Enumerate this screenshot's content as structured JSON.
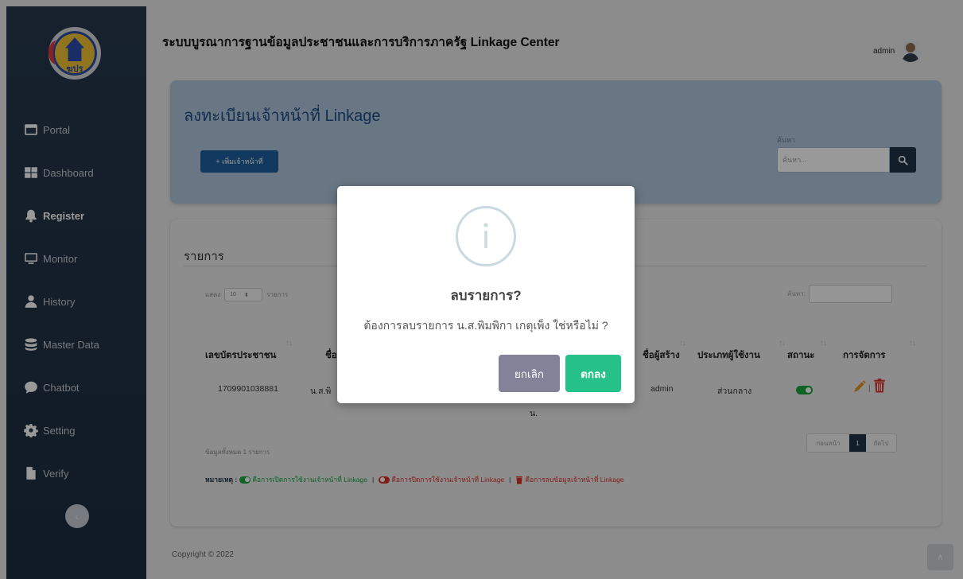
{
  "app": {
    "title": "ระบบบูรณาการฐานข้อมูลประชาชนและการบริการภาครัฐ Linkage Center",
    "user_name": "admin",
    "logo_text": "ฆปร"
  },
  "sidebar": {
    "items": [
      {
        "label": "Portal",
        "icon": "window-icon"
      },
      {
        "label": "Dashboard",
        "icon": "grid-icon"
      },
      {
        "label": "Register",
        "icon": "bell-icon",
        "active": true
      },
      {
        "label": "Monitor",
        "icon": "monitor-icon"
      },
      {
        "label": "History",
        "icon": "user-icon"
      },
      {
        "label": "Master Data",
        "icon": "database-icon"
      },
      {
        "label": "Chatbot",
        "icon": "chat-bubble-icon"
      },
      {
        "label": "Setting",
        "icon": "gear-icon"
      },
      {
        "label": "Verify",
        "icon": "document-icon"
      }
    ],
    "collapse_glyph": "‹"
  },
  "register_card": {
    "title": "ลงทะเบียนเจ้าหน้าที่ Linkage",
    "add_button_label": "+ เพิ่มเจ้าหน้าที่",
    "search_label": "ค้นหา",
    "search_placeholder": "ค้นหา..."
  },
  "list_card": {
    "title": "รายการ",
    "show_prefix": "แสดง",
    "show_value": "10",
    "show_suffix": "รายการ",
    "filter_label": "ค้นหา:",
    "columns": [
      "เลขบัตรประชาชน",
      "ชื่อ",
      "ชื่อผู้สร้าง",
      "ประเภทผู้ใช้งาน",
      "สถานะ",
      "การจัดการ"
    ],
    "rows": [
      {
        "id_number": "1709901038881",
        "name_visible": "น.ส.พิ",
        "name_wrap": "น.",
        "creator": "admin",
        "user_type": "ส่วนกลาง",
        "status": "enabled"
      }
    ],
    "info": "ข้อมูลทั้งหมด 1 รายการ",
    "pagination": {
      "prev": "ก่อนหน้า",
      "current": "1",
      "next": "ถัดไป"
    },
    "legend": {
      "label": "หมายเหตุ :",
      "on_text": "คือการเปิดการใช้งานเจ้าหน้าที่ Linkage",
      "off_text": "คือการปิดการใช้งานเจ้าหน้าที่ Linkage",
      "delete_text": "คือการลบข้อมูลเจ้าหน้าที่ Linkage",
      "separator": "|"
    }
  },
  "footer": {
    "copyright": "Copyright © 2022",
    "scroll_top_glyph": "˄"
  },
  "dialog": {
    "icon": "info-icon",
    "title": "ลบรายการ?",
    "message": "ต้องการลบรายการ น.ส.พิมพิกา เกตุเพ็ง ใช่หรือไม่ ?",
    "cancel_label": "ยกเลิก",
    "confirm_label": "ตกลง"
  },
  "colors": {
    "sidebar_bg": "#1f3245",
    "header_card_bg": "#adc6da",
    "primary_button": "#1d5f9f",
    "cancel_button": "#848298",
    "confirm_button": "#27c28a",
    "status_on": "#1aa53e",
    "delete_red": "#d9332b",
    "edit_orange": "#e6911e"
  }
}
